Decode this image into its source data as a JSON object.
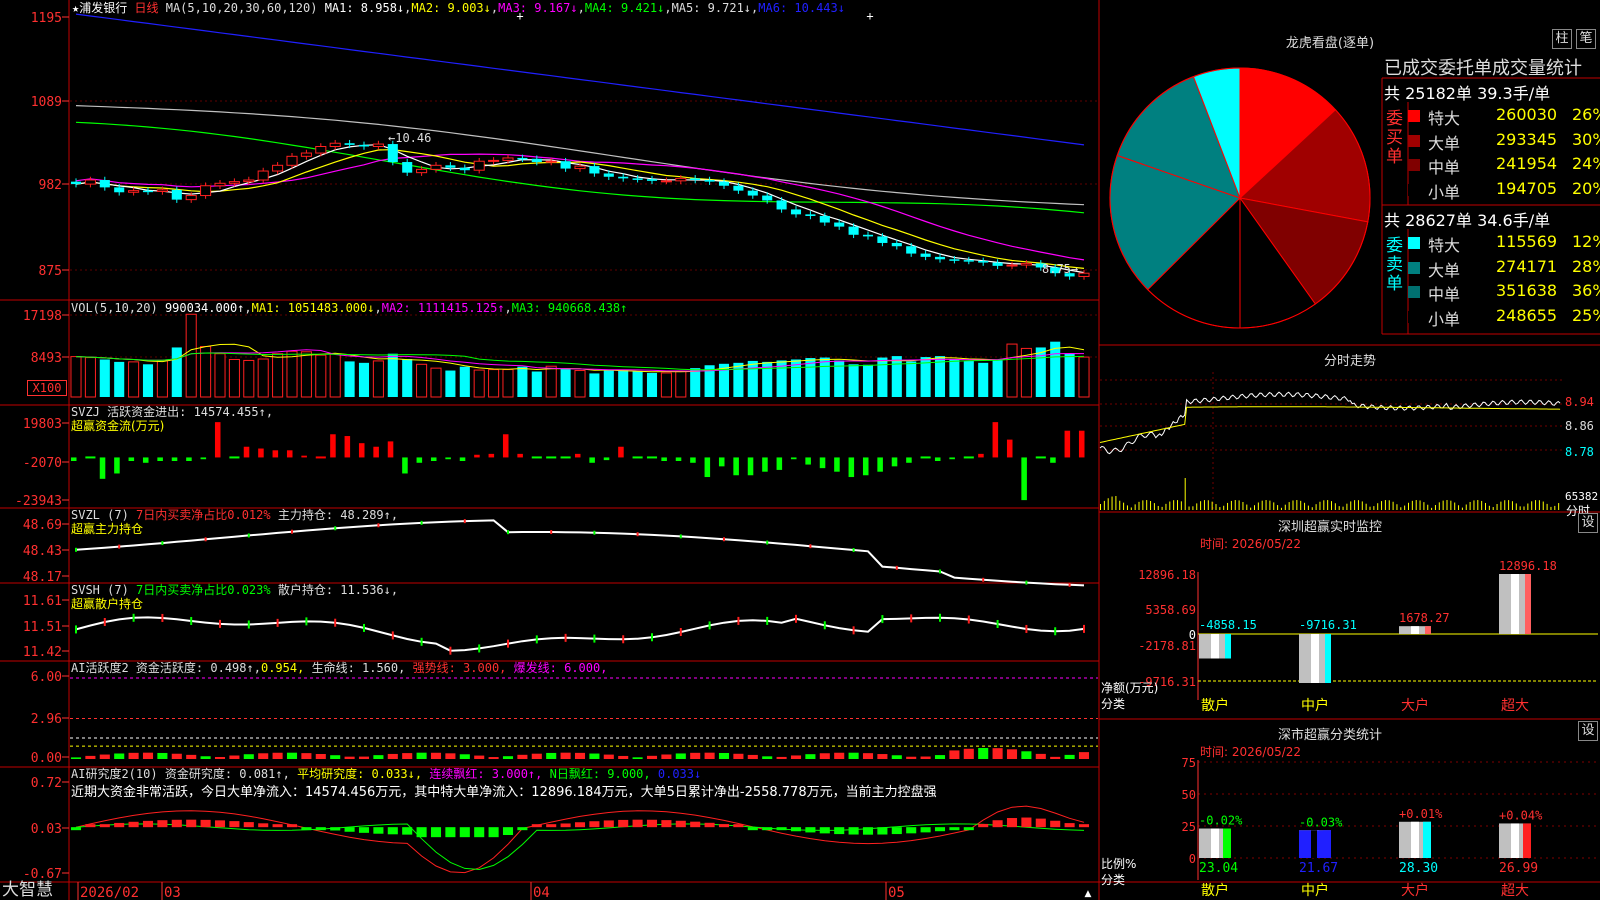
{
  "colors": {
    "up": "#ff2020",
    "down": "#00ffff",
    "ma1": "#ffffff",
    "ma2": "#ffff00",
    "ma3": "#ff00ff",
    "ma4": "#00ff00",
    "ma5": "#c0c0c0",
    "ma6": "#2020ff",
    "grid": "#b00000",
    "frame": "#c00000",
    "green": "#00ff00"
  },
  "main": {
    "title_prefix": "★",
    "stock": "浦发银行",
    "period": "日线",
    "ma_label": "MA(5,10,20,30,60,120)",
    "ma1": "MA1: 8.958↓",
    "ma2": "MA2: 9.003↓",
    "ma3": "MA3: 9.167↓",
    "ma4": "MA4: 9.421↓",
    "ma5": "MA5: 9.721↓",
    "ma6": "MA6: 10.443↓",
    "yticks": [
      "1195",
      "1089",
      "982",
      "875"
    ],
    "high_label": "←10.46",
    "low_label": "8.75→"
  },
  "vol": {
    "label": "VOL(5,10,20)",
    "value": "990034.000↑",
    "ma1": "MA1: 1051483.000↓",
    "ma2": "MA2: 1111415.125↑",
    "ma3": "MA3: 940668.438↑",
    "yticks": [
      "17198",
      "8493"
    ],
    "unit": "X100"
  },
  "svzj": {
    "line1": "SVZJ 活跃资金进出: 14574.455↑,",
    "line2": "超赢资金流(万元)",
    "yticks": [
      "19803",
      "-2070",
      "-23943"
    ]
  },
  "svzl": {
    "label": "SVZL (7)",
    "ratio": "7日内买卖净占比0.012%",
    "hold": "主力持仓: 48.289↑,",
    "line2": "超赢主力持仓",
    "yticks": [
      "48.69",
      "48.43",
      "48.17"
    ]
  },
  "svsh": {
    "label": "SVSH (7)",
    "ratio": "7日内买卖净占比0.023%",
    "hold": "散户持仓: 11.536↓,",
    "line2": "超赢散户持仓",
    "yticks": [
      "11.61",
      "11.51",
      "11.42"
    ]
  },
  "ai1": {
    "label": "AI活跃度2",
    "a": "资金活跃度: 0.498↑",
    "b": "0.954,",
    "c": "生命线: 1.560,",
    "d": "强势线: 3.000,",
    "e": "爆发线: 6.000,",
    "yticks": [
      "6.00",
      "2.96",
      "0.00"
    ]
  },
  "ai2": {
    "label": "AI研究度2(10)",
    "a": "资金研究度: 0.081↑,",
    "b": "平均研究度: 0.033↓,",
    "c": "连续飘红: 3.000↑,",
    "d": "N日飘红: 9.000,",
    "e": "0.033↓",
    "comment": "近期大资金非常活跃，今日大单净流入：14574.456万元，其中特大单净流入：12896.184万元，大单5日累计净出-2558.778万元，当前主力控盘强",
    "yticks": [
      "0.72",
      "0.03",
      "-0.67"
    ]
  },
  "bottom": {
    "brand": "大智慧",
    "dates": [
      "2026/02",
      "03",
      "04",
      "05"
    ]
  },
  "lhb": {
    "title": "龙虎看盘(逐单)",
    "btn1": "柱",
    "btn2": "笔",
    "subtitle": "已成交委托单成交量统计",
    "buy": {
      "side": "委买单",
      "summary": "共 25182单 39.3手/单",
      "rows": [
        {
          "label": "特大",
          "value": "260030",
          "pct": "26%",
          "color": "#ff0000"
        },
        {
          "label": "大单",
          "value": "293345",
          "pct": "30%",
          "color": "#a00000"
        },
        {
          "label": "中单",
          "value": "241954",
          "pct": "24%",
          "color": "#800000"
        },
        {
          "label": "小单",
          "value": "194705",
          "pct": "20%",
          "color": "#000000"
        }
      ]
    },
    "sell": {
      "side": "委卖单",
      "summary": "共 28627单 34.6手/单",
      "rows": [
        {
          "label": "特大",
          "value": "115569",
          "pct": "12%",
          "color": "#00ffff"
        },
        {
          "label": "大单",
          "value": "274171",
          "pct": "28%",
          "color": "#008080"
        },
        {
          "label": "中单",
          "value": "351638",
          "pct": "36%",
          "color": "#007070"
        },
        {
          "label": "小单",
          "value": "248655",
          "pct": "25%",
          "color": "#000000"
        }
      ]
    }
  },
  "intraday": {
    "title": "分时走势",
    "yticks": [
      "8.94",
      "8.86",
      "8.78"
    ],
    "vol_label": "65382",
    "unit": "分时"
  },
  "monitor": {
    "title": "深圳超赢实时监控",
    "btn": "设",
    "time": "时间: 2026/05/22",
    "yticks": [
      "12896.18",
      "5358.69",
      "0",
      "-2178.81",
      "-9716.31"
    ],
    "ylabel1": "净额(万元)",
    "ylabel2": "分类",
    "bars": [
      {
        "cat": "散户",
        "value": -4858.15,
        "label": "-4858.15"
      },
      {
        "cat": "中户",
        "value": -9716.31,
        "label": "-9716.31"
      },
      {
        "cat": "大户",
        "value": 1678.27,
        "label": "1678.27"
      },
      {
        "cat": "超大",
        "value": 12896.18,
        "label": "12896.18"
      }
    ]
  },
  "classify": {
    "title": "深市超赢分类统计",
    "btn": "设",
    "time": "时间: 2026/05/22",
    "yticks": [
      "75",
      "50",
      "25",
      "0"
    ],
    "ylabel1": "比例%",
    "ylabel2": "分类",
    "bars": [
      {
        "cat": "散户",
        "value": 23.04,
        "label": "23.04",
        "chg": "-0.02%",
        "color": "#00ff00"
      },
      {
        "cat": "中户",
        "value": 21.67,
        "label": "21.67",
        "chg": "-0.03%",
        "color": "#2020ff"
      },
      {
        "cat": "大户",
        "value": 28.3,
        "label": "28.30",
        "chg": "+0.01%",
        "color": "#00ffff"
      },
      {
        "cat": "超大",
        "value": 26.99,
        "label": "26.99",
        "chg": "+0.04%",
        "color": "#ff2020"
      }
    ]
  },
  "chart_data": [
    {
      "type": "candlestick",
      "name": "浦发银行 日线",
      "ma_periods": [
        5,
        10,
        20,
        30,
        60,
        120
      ],
      "closes": [
        9.92,
        9.97,
        9.88,
        9.82,
        9.84,
        9.83,
        9.85,
        9.73,
        9.78,
        9.9,
        9.93,
        9.95,
        9.97,
        10.08,
        10.15,
        10.26,
        10.3,
        10.38,
        10.42,
        10.4,
        10.38,
        10.41,
        10.19,
        10.06,
        10.1,
        10.15,
        10.12,
        10.09,
        10.2,
        10.21,
        10.24,
        10.23,
        10.19,
        10.2,
        10.11,
        10.14,
        10.05,
        10.01,
        9.99,
        9.98,
        9.96,
        9.96,
        9.99,
        9.97,
        9.95,
        9.9,
        9.84,
        9.78,
        9.72,
        9.61,
        9.55,
        9.53,
        9.45,
        9.4,
        9.3,
        9.28,
        9.2,
        9.16,
        9.07,
        9.03,
        9.0,
        8.99,
        8.98,
        8.96,
        8.92,
        8.93,
        8.95,
        8.9,
        8.83,
        8.79,
        8.83
      ]
    },
    {
      "type": "bar",
      "name": "VOL",
      "values": [
        8400,
        8200,
        7800,
        7300,
        7300,
        6800,
        7600,
        10300,
        17198,
        10500,
        9000,
        7800,
        7600,
        7900,
        9000,
        9500,
        9400,
        8700,
        8900,
        7400,
        7100,
        7500,
        9000,
        7900,
        6800,
        6000,
        5500,
        6300,
        5600,
        5700,
        5700,
        6300,
        5300,
        6400,
        5800,
        5500,
        4900,
        5500,
        5600,
        5300,
        5000,
        5000,
        5300,
        6000,
        6600,
        6900,
        7100,
        7500,
        7300,
        7600,
        7800,
        8100,
        8200,
        7600,
        6800,
        6700,
        8200,
        8500,
        7400,
        8300,
        8500,
        7900,
        7500,
        7100,
        7600,
        11000,
        10100,
        10300,
        11500,
        9000,
        8300
      ]
    },
    {
      "type": "bar",
      "name": "超赢资金流",
      "values": [
        -2000,
        -500,
        -12000,
        -9000,
        -2000,
        -3000,
        -2000,
        -2000,
        -2000,
        -1000,
        19803,
        -500,
        6000,
        5000,
        4000,
        4000,
        1000,
        0,
        13000,
        12000,
        8000,
        6000,
        9000,
        -9000,
        -3000,
        -2000,
        -1000,
        -2000,
        1500,
        2000,
        13000,
        2000,
        -500,
        -500,
        -500,
        2000,
        -3000,
        -1500,
        6000,
        -500,
        -500,
        -2000,
        -2000,
        -3000,
        -11000,
        -5000,
        -10000,
        -10000,
        -8000,
        -7000,
        -1000,
        -4000,
        -6000,
        -8000,
        -11000,
        -10000,
        -8000,
        -5000,
        -3000,
        -500,
        -2000,
        -1000,
        -500,
        2000,
        19803,
        10000,
        -23943,
        -500,
        -3000,
        15000,
        15000
      ]
    },
    {
      "type": "line",
      "name": "超赢主力持仓",
      "range": [
        48.17,
        48.69
      ]
    },
    {
      "type": "line",
      "name": "超赢散户持仓",
      "range": [
        11.42,
        11.61
      ]
    },
    {
      "type": "bar",
      "name": "AI活跃度2",
      "range": [
        0,
        6
      ]
    },
    {
      "type": "bar",
      "name": "AI研究度2",
      "range": [
        -0.67,
        0.72
      ]
    },
    {
      "type": "pie",
      "name": "龙虎看盘(逐单)",
      "slices": [
        {
          "label": "特大买",
          "value": 260030
        },
        {
          "label": "大单买",
          "value": 293345
        },
        {
          "label": "中单买",
          "value": 241954
        },
        {
          "label": "小单买",
          "value": 194705
        },
        {
          "label": "小单卖",
          "value": 248655
        },
        {
          "label": "中单卖",
          "value": 351638
        },
        {
          "label": "大单卖",
          "value": 274171
        },
        {
          "label": "特大卖",
          "value": 115569
        }
      ]
    },
    {
      "type": "line",
      "name": "分时走势",
      "ylim": [
        8.74,
        8.98
      ]
    },
    {
      "type": "bar",
      "name": "深圳超赢实时监控",
      "categories": [
        "散户",
        "中户",
        "大户",
        "超大"
      ],
      "values": [
        -4858.15,
        -9716.31,
        1678.27,
        12896.18
      ]
    },
    {
      "type": "bar",
      "name": "深市超赢分类统计",
      "categories": [
        "散户",
        "中户",
        "大户",
        "超大"
      ],
      "values": [
        23.04,
        21.67,
        28.3,
        26.99
      ]
    }
  ]
}
